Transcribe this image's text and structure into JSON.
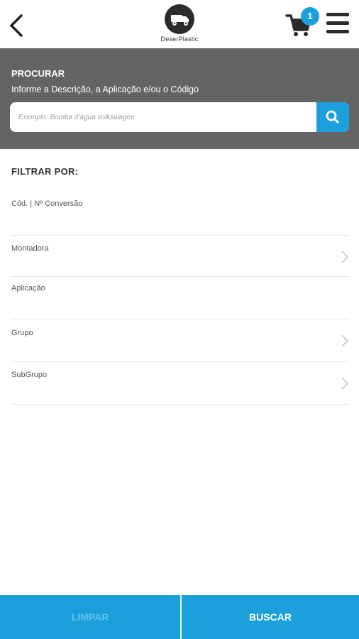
{
  "header": {
    "logo_text": "DeserPlastic",
    "cart_count": "1"
  },
  "search": {
    "title": "PROCURAR",
    "subtitle": "Informe a Descrição, a Aplicação e/ou o Código",
    "placeholder": "Exemplo: Bomba d'água volkswagen"
  },
  "filters": {
    "heading": "FILTRAR POR:",
    "items": [
      {
        "label": "Cód. | Nº Conversão",
        "has_chevron": false
      },
      {
        "label": "Montadora",
        "has_chevron": true
      },
      {
        "label": "Aplicação",
        "has_chevron": false
      },
      {
        "label": "Grupo",
        "has_chevron": true
      },
      {
        "label": "SubGrupo",
        "has_chevron": true
      }
    ]
  },
  "footer": {
    "clear_label": "LIMPAR",
    "search_label": "BUSCAR"
  },
  "colors": {
    "accent": "#1ba0dc",
    "panel": "#636466",
    "dark": "#2b2b2b"
  }
}
